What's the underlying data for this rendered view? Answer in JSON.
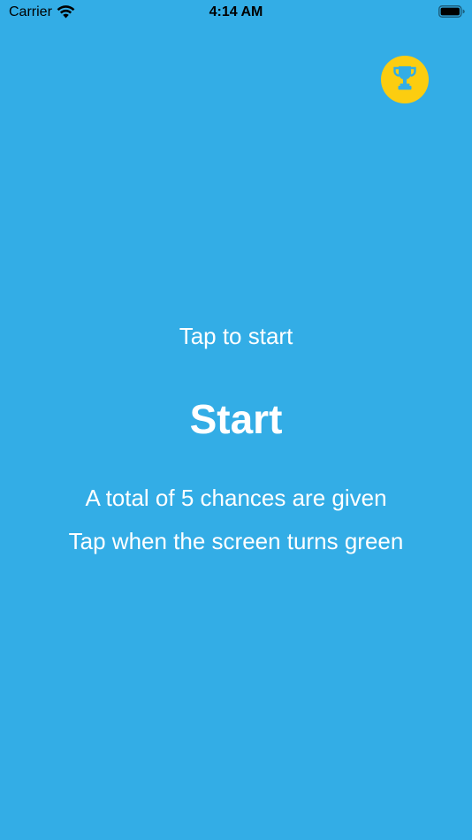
{
  "status_bar": {
    "carrier": "Carrier",
    "time": "4:14 AM",
    "wifi_icon": "wifi-icon",
    "battery_icon": "battery-icon"
  },
  "leaderboard": {
    "icon": "trophy-icon",
    "color": "#fccd10"
  },
  "main": {
    "prompt": "Tap to start",
    "title": "Start",
    "instructions": [
      "A total of 5 chances are given",
      "Tap when the screen turns green"
    ]
  },
  "colors": {
    "background": "#33ade6",
    "text": "#ffffff"
  }
}
